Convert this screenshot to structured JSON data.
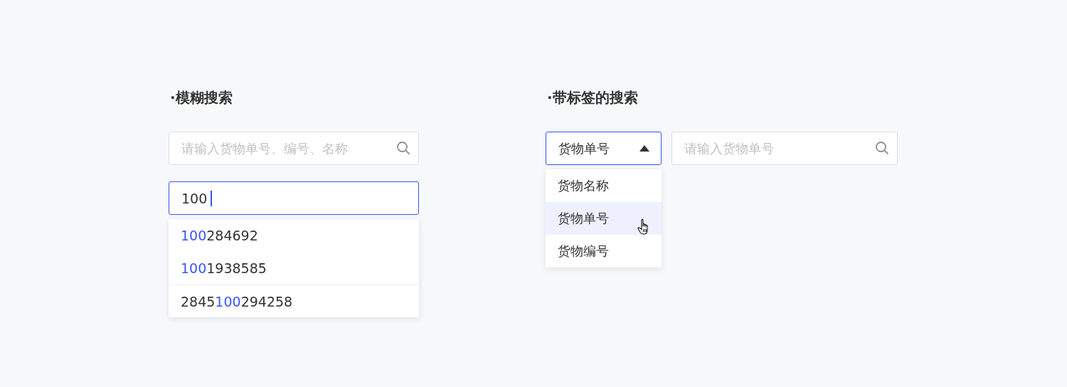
{
  "fuzzy_search": {
    "title": "·模糊搜索",
    "search_field": {
      "placeholder": "请输入货物单号、编号、名称"
    },
    "active_field": {
      "value": "100",
      "focused": true
    },
    "suggestions": [
      {
        "parts": [
          {
            "text": "100",
            "match": true
          },
          {
            "text": "284692",
            "match": false
          }
        ],
        "divider": false
      },
      {
        "parts": [
          {
            "text": "100",
            "match": true
          },
          {
            "text": "1938585",
            "match": false
          }
        ],
        "divider": false
      },
      {
        "parts": [
          {
            "text": "2845",
            "match": false
          },
          {
            "text": "100",
            "match": true
          },
          {
            "text": "294258",
            "match": false
          }
        ],
        "divider": true
      }
    ]
  },
  "tag_search": {
    "title": "·带标签的搜索",
    "tag_select": {
      "value": "货物单号",
      "expanded": true
    },
    "search_field": {
      "placeholder": "请输入货物单号"
    },
    "options": [
      {
        "label": "货物名称",
        "hovered": false
      },
      {
        "label": "货物单号",
        "hovered": true
      },
      {
        "label": "货物编号",
        "hovered": false
      }
    ]
  }
}
